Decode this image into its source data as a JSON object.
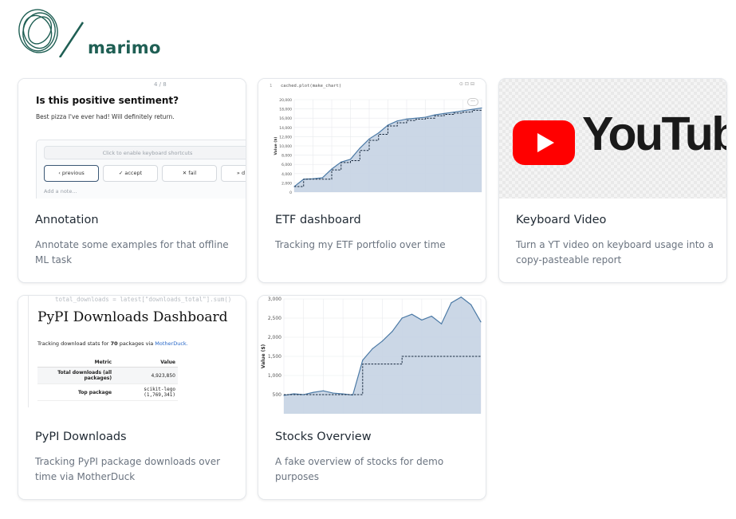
{
  "brand": {
    "name": "marimo",
    "color": "#1f5f54"
  },
  "cards": [
    {
      "title": "Annotation",
      "description": "Annotate some examples for that offline ML task",
      "thumb": {
        "counter": "4 / 8",
        "question": "Is this positive sentiment?",
        "text": "Best pizza I've ever had! Will definitely return.",
        "shortcuts": "Click to enable keyboard shortcuts",
        "buttons": [
          "‹ previous",
          "✓ accept",
          "✕ fail",
          "» d"
        ],
        "note_placeholder": "Add a note..."
      }
    },
    {
      "title": "ETF dashboard",
      "description": "Tracking my ETF portfolio over time",
      "thumb": {
        "code_line": "1",
        "code": "cached.plot(make_chart)",
        "more": "···"
      }
    },
    {
      "title": "Keyboard Video",
      "description": "Turn a YT video on keyboard usage into a copy-pasteable report",
      "thumb": {
        "logo_text": "YouTube",
        "logo_color": "#ff0000"
      }
    },
    {
      "title": "PyPI Downloads",
      "description": "Tracking PyPI package downloads over time via MotherDuck",
      "thumb": {
        "code": "total_downloads = latest[\"downloads_total\"].sum()",
        "heading": "PyPI Downloads Dashboard",
        "sub_prefix": "Tracking download stats for",
        "sub_count": "70",
        "sub_middle": "packages via",
        "sub_link": "MotherDuck.",
        "table": {
          "headers": [
            "Metric",
            "Value"
          ],
          "rows": [
            [
              "Total downloads (all packages)",
              "4,923,850"
            ],
            [
              "Top package",
              "scikit-lego (1,769,341)"
            ]
          ]
        }
      }
    },
    {
      "title": "Stocks Overview",
      "description": "A fake overview of stocks for demo purposes",
      "thumb": {}
    }
  ],
  "chart_data": [
    {
      "type": "area",
      "ylabel": "Value ($)",
      "ylim": [
        0,
        20000
      ],
      "yticks": [
        "0",
        "2,000",
        "4,000",
        "6,000",
        "8,000",
        "10,000",
        "12,000",
        "14,000",
        "16,000",
        "18,000",
        "20,000"
      ],
      "grid": true,
      "x": [
        0,
        5,
        10,
        15,
        20,
        25,
        30,
        35,
        40,
        45,
        50,
        55,
        60,
        65,
        70,
        75,
        80,
        85,
        90,
        95,
        100
      ],
      "series": [
        {
          "values": [
            1200,
            2800,
            2900,
            3100,
            5000,
            6500,
            7100,
            9500,
            11500,
            12800,
            14500,
            15400,
            15800,
            16000,
            16200,
            16700,
            17000,
            17300,
            17600,
            17900,
            18200
          ],
          "color": "#4c7aa6"
        },
        {
          "values": [
            1200,
            2800,
            2800,
            2800,
            4800,
            6400,
            6800,
            9000,
            11200,
            12500,
            14300,
            15000,
            15500,
            15800,
            16000,
            16500,
            16800,
            17100,
            17300,
            17700,
            17900
          ],
          "style": "dashed",
          "color": "#1a2b40"
        }
      ]
    },
    {
      "type": "area",
      "ylabel": "Value ($)",
      "ylim": [
        0,
        3000
      ],
      "yticks": [
        "500",
        "1,000",
        "1,500",
        "2,000",
        "2,500",
        "3,000"
      ],
      "grid": true,
      "x": [
        0,
        5,
        10,
        15,
        20,
        25,
        30,
        35,
        40,
        45,
        50,
        55,
        60,
        65,
        70,
        75,
        80,
        85,
        90,
        95,
        100
      ],
      "series": [
        {
          "values": [
            480,
            520,
            500,
            560,
            600,
            540,
            520,
            490,
            1400,
            1700,
            1900,
            2150,
            2500,
            2600,
            2450,
            2550,
            2350,
            2900,
            3050,
            2850,
            2400
          ],
          "color": "#4c7aa6"
        },
        {
          "values": [
            500,
            500,
            500,
            500,
            500,
            500,
            500,
            500,
            1300,
            1300,
            1300,
            1300,
            1500,
            1500,
            1500,
            1500,
            1500,
            1500,
            1500,
            1500,
            1500
          ],
          "style": "dashed",
          "color": "#1a2b40"
        }
      ]
    }
  ]
}
